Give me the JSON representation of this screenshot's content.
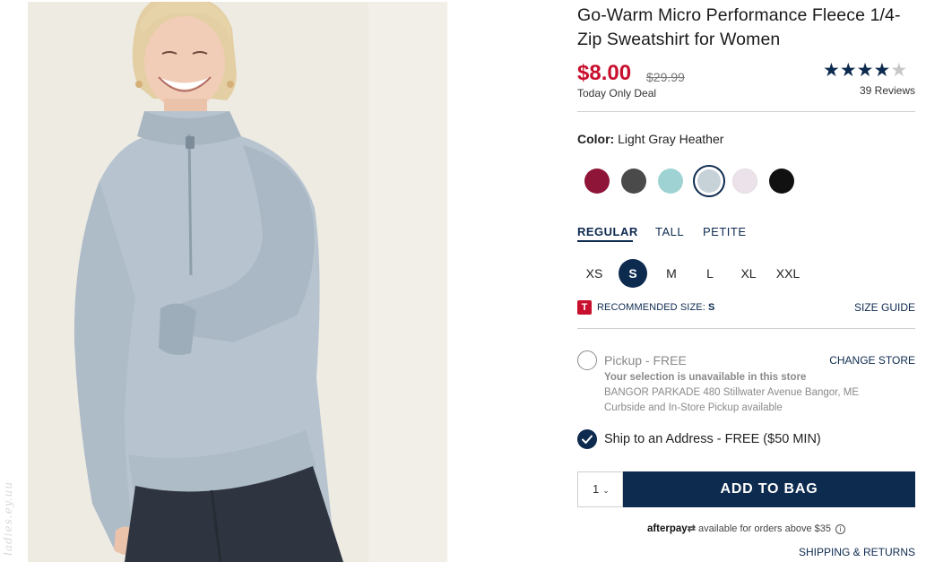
{
  "product": {
    "title": "Go-Warm Micro Performance Fleece 1/4-Zip Sweatshirt for Women",
    "price": "$8.00",
    "original_price": "$29.99",
    "deal_label": "Today Only Deal",
    "rating": 4,
    "rating_max": 5,
    "reviews": "39 Reviews"
  },
  "color": {
    "label": "Color:",
    "selected": "Light Gray Heather",
    "swatches": [
      {
        "name": "burgundy",
        "hex": "#8e1438"
      },
      {
        "name": "charcoal-camo",
        "hex": "#4a4a4a"
      },
      {
        "name": "aqua",
        "hex": "#9fd3d3"
      },
      {
        "name": "light-gray-heather",
        "hex": "#c6d1d8",
        "selected": true
      },
      {
        "name": "pale-lilac",
        "hex": "#ece3ea"
      },
      {
        "name": "black",
        "hex": "#111111"
      }
    ]
  },
  "fit_tabs": [
    "REGULAR",
    "TALL",
    "PETITE"
  ],
  "fit_selected": "REGULAR",
  "sizes": [
    "XS",
    "S",
    "M",
    "L",
    "XL",
    "XXL"
  ],
  "size_selected": "S",
  "recommended": {
    "icon": "T",
    "label": "RECOMMENDED SIZE:",
    "value": "S",
    "size_guide": "SIZE GUIDE"
  },
  "pickup": {
    "label": "Pickup - FREE",
    "change_store": "CHANGE STORE",
    "unavailable": "Your selection is unavailable in this store",
    "store_address": "BANGOR PARKADE 480 Stillwater Avenue  Bangor, ME",
    "curbside": "Curbside and In-Store Pickup available"
  },
  "shipping": {
    "label": "Ship to an Address - FREE ($50 MIN)",
    "checked": true
  },
  "cart": {
    "quantity": "1",
    "add_label": "ADD TO BAG"
  },
  "afterpay": {
    "logo": "afterpay",
    "text": "available for orders above $35",
    "info_icon": "i"
  },
  "links": {
    "shipping_returns": "SHIPPING & RETURNS"
  },
  "watermark": "ladies.ey.uu",
  "colors": {
    "navy": "#0d2a4f",
    "sale_red": "#c8102e"
  }
}
